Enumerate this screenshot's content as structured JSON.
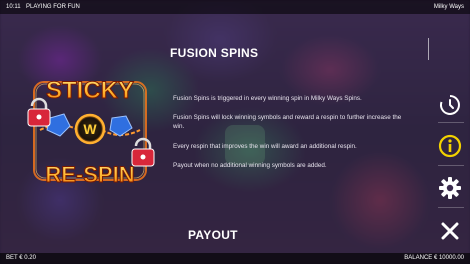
{
  "topbar": {
    "time": "10:11",
    "mode": "PLAYING FOR FUN",
    "game": "Milky Ways"
  },
  "art": {
    "line1": "STICKY",
    "line2": "RE-SPIN",
    "symbol": "W"
  },
  "section": {
    "title": "FUSION SPINS",
    "paragraphs": [
      "Fusion Spins is triggered in every winning spin in Milky Ways Spins.",
      "Fusion Spins will lock winning symbols and reward a respin to further increase the win.",
      "Every respin that improves the win will award an additional respin.",
      "Payout when no additional winning symbols are added."
    ]
  },
  "next_section": {
    "title": "PAYOUT"
  },
  "sidebar": {
    "icons": [
      "history-icon",
      "info-icon",
      "settings-icon",
      "close-icon"
    ],
    "info_color": "#f2d200"
  },
  "bottombar": {
    "bet_label": "BET",
    "bet_value": "€ 0.20",
    "balance_label": "BALANCE",
    "balance_value": "€ 10000.00"
  }
}
